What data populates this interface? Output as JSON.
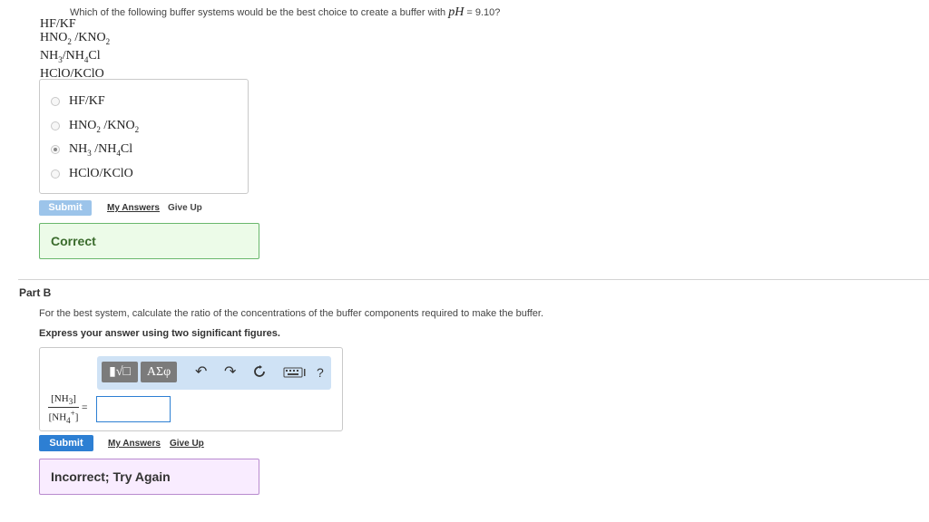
{
  "partA": {
    "question_prefix": "Which of the following buffer systems would be the best choice to create a buffer with",
    "question_var": "pH",
    "question_suffix": " = 9.10?",
    "listed_formulas": [
      {
        "a": "HF",
        "b": "KF"
      },
      {
        "a1": "HNO",
        "a_sub": "2",
        "b1": "KNO",
        "b_sub": "2"
      },
      {
        "a1": "NH",
        "a_sub": "3",
        "b1": "NH",
        "b_sub": "4",
        "b2": "Cl"
      },
      {
        "a": "HClO",
        "b": "KClO"
      }
    ],
    "choices": [
      {
        "a": "HF",
        "b": "KF",
        "selected": false
      },
      {
        "a1": "HNO",
        "a_sub": "2",
        "b1": "KNO",
        "b_sub": "2",
        "selected": false
      },
      {
        "a1": "NH",
        "a_sub": "3",
        "b1": "NH",
        "b_sub": "4",
        "b2": "Cl",
        "selected": true
      },
      {
        "a": "HClO",
        "b": "KClO",
        "selected": false
      }
    ],
    "submit_label": "Submit",
    "my_answers_label": "My Answers",
    "give_up_label": "Give Up",
    "feedback": "Correct"
  },
  "partB": {
    "label": "Part B",
    "instruction": "For the best system, calculate the ratio of the concentrations of the buffer components required to make the buffer.",
    "express": "Express your answer using two significant figures.",
    "toolbar": {
      "templates_symbol": "▮√□",
      "greek_symbol": "ΑΣφ",
      "undo_icon": "undo-icon",
      "redo_icon": "redo-icon",
      "reset_icon": "reset-icon",
      "keyboard_icon": "keyboard-icon",
      "help_symbol": "?"
    },
    "fraction": {
      "num_base": "NH",
      "num_sub": "3",
      "den_base": "NH",
      "den_sup": "+",
      "den_sub": "4"
    },
    "equals": "=",
    "answer_value": "",
    "submit_label": "Submit",
    "my_answers_label": "My Answers",
    "give_up_label": "Give Up",
    "feedback": "Incorrect; Try Again"
  },
  "colors": {
    "submit_blue": "#2d7fd3",
    "correct_border": "#69b76c",
    "correct_bg": "#ecfbe8",
    "incorrect_border": "#b88bcf",
    "incorrect_bg": "#f9ecff",
    "toolbar_bg": "#cfe2f5"
  }
}
